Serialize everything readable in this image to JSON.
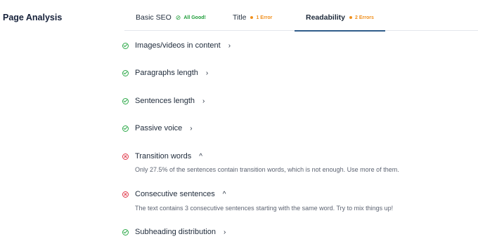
{
  "section_title": "Page Analysis",
  "tabs": [
    {
      "label": "Basic SEO",
      "status": "All Good!",
      "status_type": "good",
      "icon": "check-circle-icon"
    },
    {
      "label": "Title",
      "status": "1 Error",
      "status_type": "warn",
      "icon": "dot-icon"
    },
    {
      "label": "Readability",
      "status": "2 Errors",
      "status_type": "warn",
      "icon": "dot-icon",
      "active": true
    }
  ],
  "checks": [
    {
      "label": "Images/videos in content",
      "state": "ok",
      "chevron": "›"
    },
    {
      "label": "Paragraphs length",
      "state": "ok",
      "chevron": "›"
    },
    {
      "label": "Sentences length",
      "state": "ok",
      "chevron": "›"
    },
    {
      "label": "Passive voice",
      "state": "ok",
      "chevron": "›"
    },
    {
      "label": "Transition words",
      "state": "error",
      "chevron": "^",
      "description": "Only 27.5% of the sentences contain transition words, which is not enough. Use more of them."
    },
    {
      "label": "Consecutive sentences",
      "state": "error",
      "chevron": "^",
      "description": "The text contains 3 consecutive sentences starting with the same word. Try to mix things up!"
    },
    {
      "label": "Subheading distribution",
      "state": "ok",
      "chevron": "›"
    }
  ],
  "colors": {
    "good": "#2eaa4a",
    "warn": "#f0901e",
    "error": "#e0394a",
    "accent": "#2f5d8a"
  }
}
